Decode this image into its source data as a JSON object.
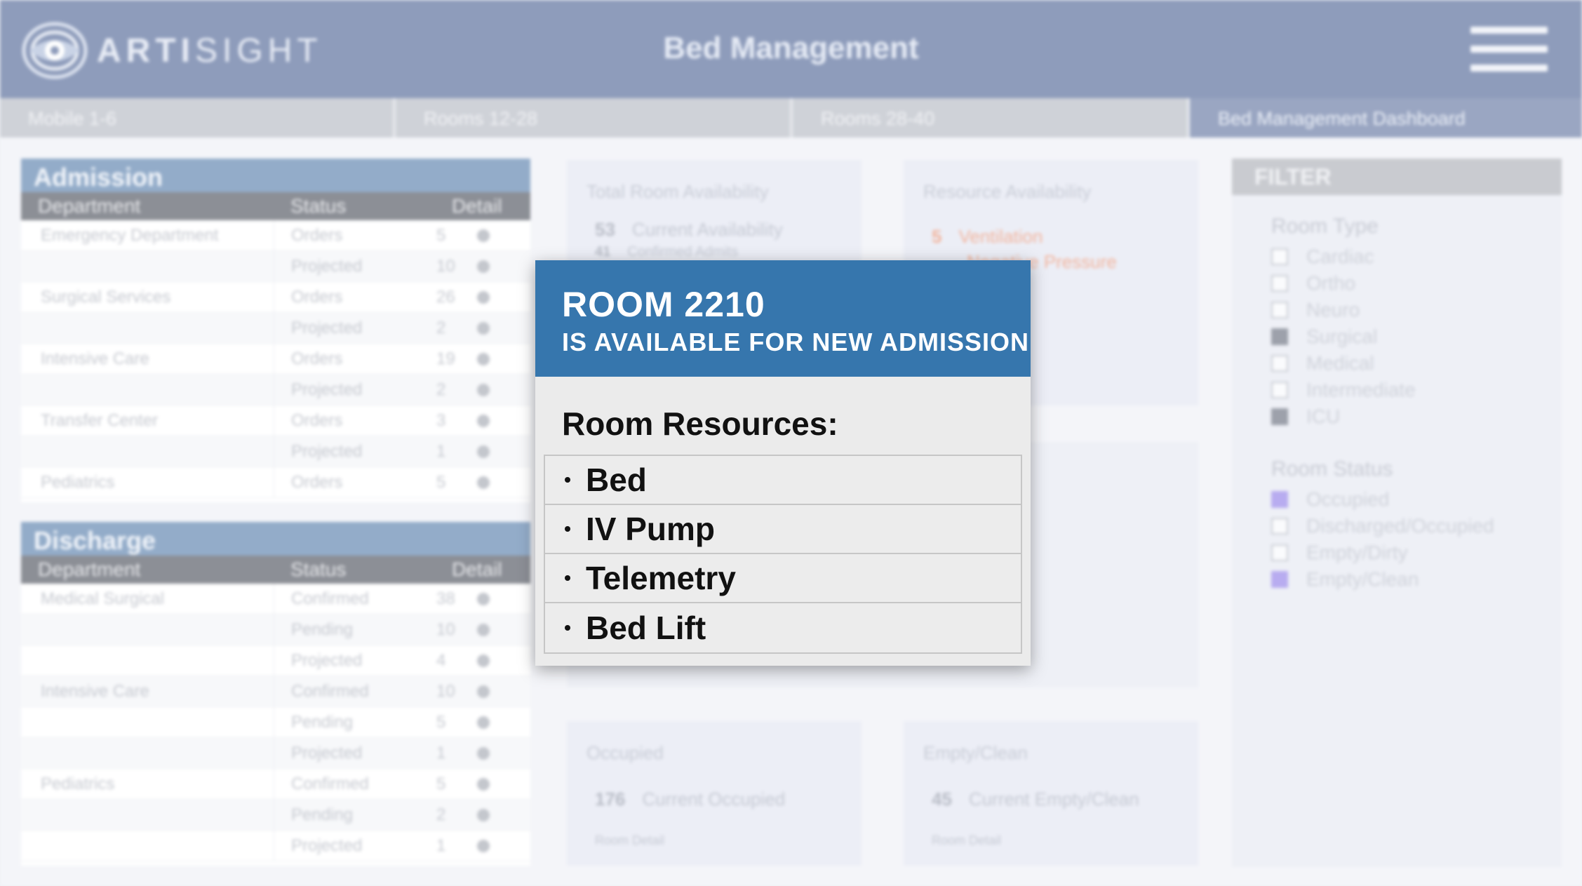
{
  "app": {
    "brand_prefix": "ARTI",
    "brand_suffix": "SIGHT",
    "title": "Bed Management"
  },
  "tabs": [
    {
      "label": "Mobile 1-6"
    },
    {
      "label": "Rooms 12-28"
    },
    {
      "label": "Rooms 28-40"
    },
    {
      "label": "Bed Management Dashboard"
    }
  ],
  "admission": {
    "title": "Admission",
    "columns": [
      "Department",
      "Status",
      "Detail"
    ],
    "rows": [
      {
        "dept": "Emergency Department",
        "status": "Orders",
        "value": "5"
      },
      {
        "dept": "",
        "status": "Projected",
        "value": "10"
      },
      {
        "dept": "Surgical Services",
        "status": "Orders",
        "value": "26"
      },
      {
        "dept": "",
        "status": "Projected",
        "value": "2"
      },
      {
        "dept": "Intensive Care",
        "status": "Orders",
        "value": "19"
      },
      {
        "dept": "",
        "status": "Projected",
        "value": "2"
      },
      {
        "dept": "Transfer Center",
        "status": "Orders",
        "value": "3"
      },
      {
        "dept": "",
        "status": "Projected",
        "value": "1"
      },
      {
        "dept": "Pediatrics",
        "status": "Orders",
        "value": "5"
      }
    ]
  },
  "discharge": {
    "title": "Discharge",
    "columns": [
      "Department",
      "Status",
      "Detail"
    ],
    "rows": [
      {
        "dept": "Medical Surgical",
        "status": "Confirmed",
        "value": "38"
      },
      {
        "dept": "",
        "status": "Pending",
        "value": "10"
      },
      {
        "dept": "",
        "status": "Projected",
        "value": "4"
      },
      {
        "dept": "Intensive Care",
        "status": "Confirmed",
        "value": "10"
      },
      {
        "dept": "",
        "status": "Pending",
        "value": "5"
      },
      {
        "dept": "",
        "status": "Projected",
        "value": "1"
      },
      {
        "dept": "Pediatrics",
        "status": "Confirmed",
        "value": "5"
      },
      {
        "dept": "",
        "status": "Pending",
        "value": "2"
      },
      {
        "dept": "",
        "status": "Projected",
        "value": "1"
      }
    ]
  },
  "cards": {
    "total_room": {
      "title": "Total Room Availability",
      "value1": "53",
      "label1": "Current Availability",
      "value2": "41",
      "label2": "Confirmed Admits"
    },
    "resource": {
      "title": "Resource Availability",
      "line1_value": "5",
      "line1_label": "Ventilation",
      "line2_label": "Negative Pressure"
    },
    "occupied": {
      "title": "Occupied",
      "value": "176",
      "label": "Current Occupied",
      "detail": "Room Detail"
    },
    "empty_clean": {
      "title": "Empty/Clean",
      "value": "45",
      "label": "Current Empty/Clean",
      "detail": "Room Detail"
    }
  },
  "filter": {
    "title": "FILTER",
    "room_type_label": "Room Type",
    "room_types": [
      "Cardiac",
      "Ortho",
      "Neuro",
      "Surgical",
      "Medical",
      "Intermediate",
      "ICU"
    ],
    "room_status_label": "Room Status",
    "room_statuses": [
      "Occupied",
      "Discharged/Occupied",
      "Empty/Dirty",
      "Empty/Clean"
    ]
  },
  "popup": {
    "title": "ROOM 2210",
    "subtitle": "IS AVAILABLE FOR NEW ADMISSION",
    "resources_label": "Room Resources:",
    "resources": [
      "Bed",
      "IV Pump",
      "Telemetry",
      "Bed Lift"
    ],
    "header_color": "#3676ad"
  }
}
